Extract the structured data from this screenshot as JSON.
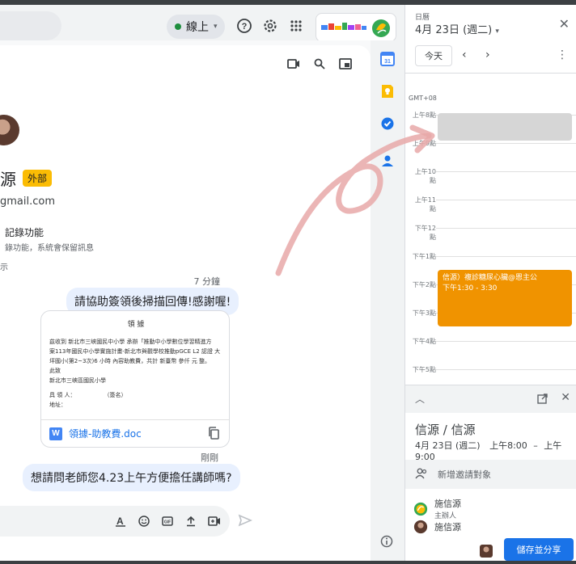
{
  "topbar": {
    "status_label": "線上",
    "status_color": "#1e8e3e",
    "icons": [
      "help-icon",
      "gear-icon",
      "apps-grid-icon"
    ]
  },
  "chat": {
    "contact_name_fragment": "源",
    "external_badge": "外部",
    "email_fragment": "gmail.com",
    "history_label": "記錄功能",
    "history_desc": "錄功能，系統會保留訊息",
    "history_more": "示",
    "msg1_time": "7 分鐘",
    "msg1_text": "請協助簽領後掃描回傳!感謝喔!",
    "attachment": {
      "preview_title": "領 據",
      "preview_lines": [
        "茲收到 新北市三峽國民中小學 承辦「推動中小學數位學習精進方",
        "案113年國民中小學實施計畫-新北市與觀學校推動pGCE L2 認證 大",
        "坪國小(第2~3次)6 小時 內容助教費，共計 新臺幣 參仟 元 整。",
        "此致",
        "新北市三峽區國民小學",
        "具 領 人：　　　　　　（簽名）",
        "地址："
      ],
      "file_name": "領據-助教費.doc"
    },
    "msg2_time": "剛剛",
    "msg2_text": "想請問老師您4.23上午方便擔任講師嗎?"
  },
  "calendar": {
    "app_label": "日曆",
    "date_label": "4月 23日 (週二)",
    "today_button": "今天",
    "timezone": "GMT+08",
    "hours": [
      "上午8點",
      "上午9點",
      "上午10點",
      "上午11點",
      "下午12點",
      "下午1點",
      "下午2點",
      "下午3點",
      "下午4點",
      "下午5點"
    ],
    "event_title": "信源）複診糖尿心臟@恩主公",
    "event_time": "下午1:30 - 3:30",
    "event_color": "#f09300",
    "form": {
      "title": "信源 / 信源",
      "date": "4月 23日 (週二)",
      "start": "上午8:00",
      "dash": "–",
      "end": "上午9:00",
      "add_guests": "新增邀請對象",
      "guest1_name": "施信源",
      "guest1_role": "主辦人",
      "guest2_name": "施信源",
      "save_button": "儲存並分享"
    }
  }
}
